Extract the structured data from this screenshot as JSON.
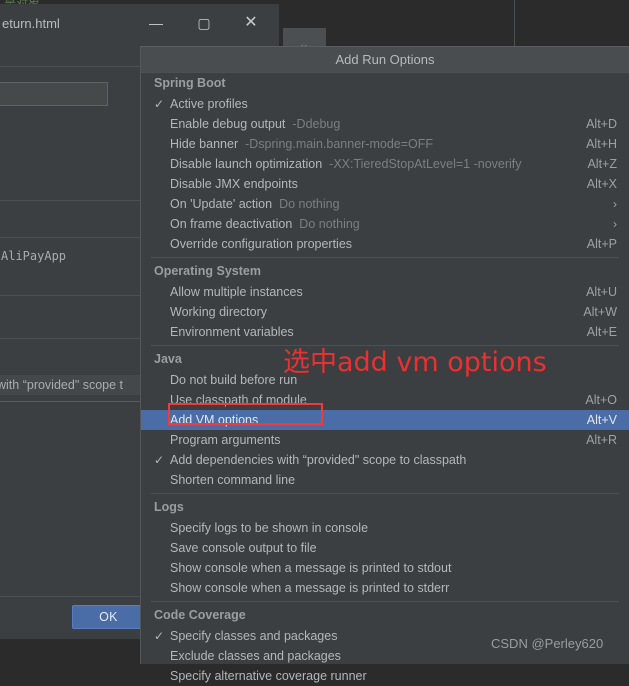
{
  "background": {
    "editor_note": "是对象",
    "window_title": "eturn.html",
    "window_controls": {
      "minimize": "—",
      "maximize": "▢",
      "close": "✕"
    },
    "app_field_value": "AliPayApp",
    "partial_row_text": "with “provided\" scope t",
    "ok_label": "OK",
    "chevron": "⌄"
  },
  "popup": {
    "title": "Add Run Options",
    "annotation_text": "选中add vm options",
    "watermark": "CSDN @Perley620",
    "groups": [
      {
        "title": "Spring Boot",
        "items": [
          {
            "check": "✓",
            "label": "Active profiles",
            "suffix": "",
            "shortcut": ""
          },
          {
            "check": "",
            "label": "Enable debug output",
            "suffix": "-Ddebug",
            "shortcut": "Alt+D"
          },
          {
            "check": "",
            "label": "Hide banner",
            "suffix": "-Dspring.main.banner-mode=OFF",
            "shortcut": "Alt+H"
          },
          {
            "check": "",
            "label": "Disable launch optimization",
            "suffix": "-XX:TieredStopAtLevel=1 -noverify",
            "shortcut": "Alt+Z"
          },
          {
            "check": "",
            "label": "Disable JMX endpoints",
            "suffix": "",
            "shortcut": "Alt+X"
          },
          {
            "check": "",
            "label": "On 'Update' action",
            "suffix": "Do nothing",
            "shortcut": "›"
          },
          {
            "check": "",
            "label": "On frame deactivation",
            "suffix": "Do nothing",
            "shortcut": "›"
          },
          {
            "check": "",
            "label": "Override configuration properties",
            "suffix": "",
            "shortcut": "Alt+P"
          }
        ]
      },
      {
        "title": "Operating System",
        "items": [
          {
            "check": "",
            "label": "Allow multiple instances",
            "suffix": "",
            "shortcut": "Alt+U"
          },
          {
            "check": "",
            "label": "Working directory",
            "suffix": "",
            "shortcut": "Alt+W"
          },
          {
            "check": "",
            "label": "Environment variables",
            "suffix": "",
            "shortcut": "Alt+E"
          }
        ]
      },
      {
        "title": "Java",
        "items": [
          {
            "check": "",
            "label": "Do not build before run",
            "suffix": "",
            "shortcut": ""
          },
          {
            "check": "",
            "label": "Use classpath of module",
            "suffix": "",
            "shortcut": "Alt+O"
          },
          {
            "check": "",
            "label": "Add VM options",
            "suffix": "",
            "shortcut": "Alt+V",
            "selected": true
          },
          {
            "check": "",
            "label": "Program arguments",
            "suffix": "",
            "shortcut": "Alt+R"
          },
          {
            "check": "✓",
            "label": "Add dependencies with “provided\" scope to classpath",
            "suffix": "",
            "shortcut": ""
          },
          {
            "check": "",
            "label": "Shorten command line",
            "suffix": "",
            "shortcut": ""
          }
        ]
      },
      {
        "title": "Logs",
        "items": [
          {
            "check": "",
            "label": "Specify logs to be shown in console",
            "suffix": "",
            "shortcut": ""
          },
          {
            "check": "",
            "label": "Save console output to file",
            "suffix": "",
            "shortcut": ""
          },
          {
            "check": "",
            "label": "Show console when a message is printed to stdout",
            "suffix": "",
            "shortcut": ""
          },
          {
            "check": "",
            "label": "Show console when a message is printed to stderr",
            "suffix": "",
            "shortcut": ""
          }
        ]
      },
      {
        "title": "Code Coverage",
        "items": [
          {
            "check": "✓",
            "label": "Specify classes and packages",
            "suffix": "",
            "shortcut": ""
          },
          {
            "check": "",
            "label": "Exclude classes and packages",
            "suffix": "",
            "shortcut": ""
          },
          {
            "check": "",
            "label": "Specify alternative coverage runner",
            "suffix": "",
            "shortcut": ""
          }
        ]
      }
    ]
  },
  "colors": {
    "menu_bg": "#3c3f41",
    "header_bg": "#4a4d4f",
    "highlight": "#4a6da7",
    "annotation_red": "#ec2f2f",
    "text": "#b4b7ba"
  }
}
